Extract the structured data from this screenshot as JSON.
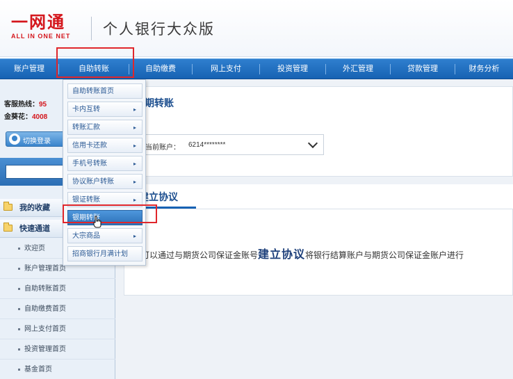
{
  "header": {
    "logo_text": "一网通",
    "logo_subtext": "ALL IN ONE NET",
    "title": "个人银行大众版"
  },
  "nav": {
    "items": [
      "账户管理",
      "自助转账",
      "自助缴费",
      "网上支付",
      "投资管理",
      "外汇管理",
      "贷款管理",
      "财务分析"
    ],
    "active": "自助转账"
  },
  "sidebar": {
    "hotline_label": "客服热线：",
    "hotline_value": "95",
    "card_label": "金葵花：",
    "card_value": "4008",
    "login_label": "切换登录",
    "groups": [
      "我的收藏",
      "快速通道"
    ],
    "links": [
      "欢迎页",
      "账户管理首页",
      "自助转账首页",
      "自助缴费首页",
      "网上支付首页",
      "投资管理首页",
      "基金首页"
    ]
  },
  "dropdown": {
    "items": [
      {
        "label": "自助转账首页",
        "has_sub": false
      },
      {
        "label": "卡内互转",
        "has_sub": true
      },
      {
        "label": "转账汇款",
        "has_sub": true
      },
      {
        "label": "信用卡还款",
        "has_sub": true
      },
      {
        "label": "手机号转账",
        "has_sub": true
      },
      {
        "label": "协议账户转账",
        "has_sub": true
      },
      {
        "label": "银证转账",
        "has_sub": true
      },
      {
        "label": "银期转账",
        "has_sub": false
      },
      {
        "label": "大宗商品",
        "has_sub": true
      },
      {
        "label": "招商银行月满计划",
        "has_sub": false
      }
    ],
    "active": "银期转账",
    "arrow_glyph": "▸"
  },
  "main": {
    "title": "期转账",
    "account_label": "当前账户：",
    "account_value": "6214********",
    "tab_label": "建立协议",
    "desc_before": "可以通过与期货公司保证金账号",
    "desc_emphasis": "建立协议",
    "desc_after": "将银行结算账户与期货公司保证金账户进行"
  },
  "colors": {
    "brand_red": "#d4161c",
    "nav_blue": "#1762b3",
    "highlight_red": "#e0262b"
  }
}
